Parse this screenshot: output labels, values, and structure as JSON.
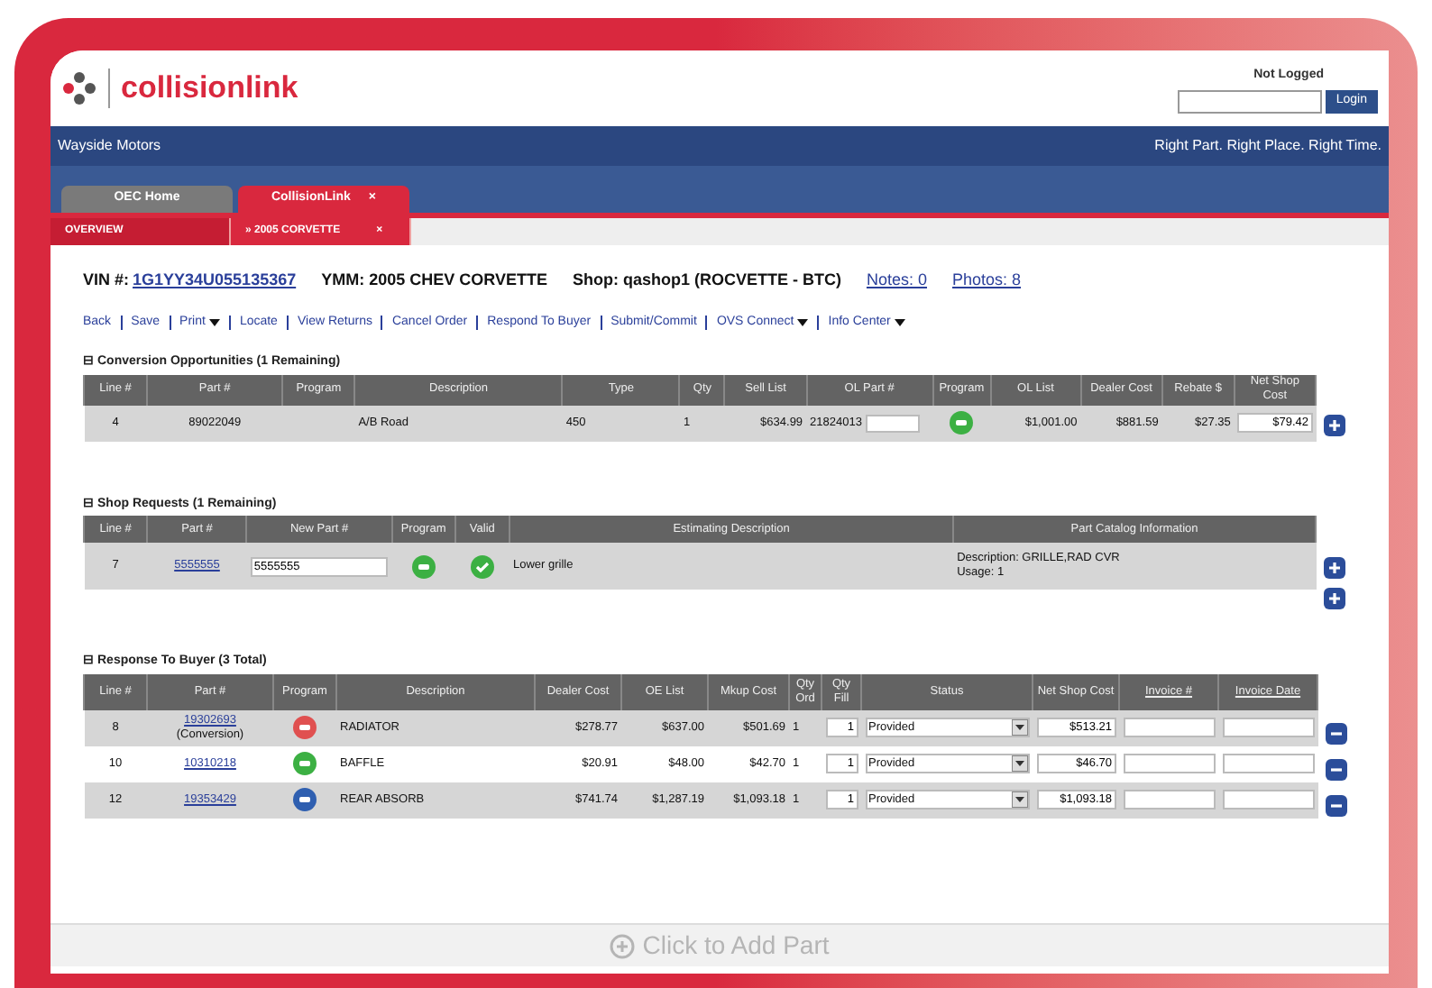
{
  "header": {
    "logo": "collisionlink",
    "login_label": "Not Logged",
    "login_button": "Login"
  },
  "nav": {
    "company": "Wayside Motors",
    "tagline": "Right Part. Right Place. Right Time."
  },
  "tabs": [
    {
      "label": "OEC Home",
      "selected": false
    },
    {
      "label": "CollisionLink",
      "selected": true,
      "close": "×"
    }
  ],
  "subtabs": [
    {
      "label": "OVERVIEW",
      "selected": false
    },
    {
      "label": "» 2005 CORVETTE",
      "selected": true,
      "close": "×"
    }
  ],
  "vehicle": {
    "vin_label": "VIN #:",
    "vin": "1G1YY34U055135367",
    "ymm": "YMM: 2005 CHEV CORVETTE",
    "shop": "Shop: qashop1 (ROCVETTE - BTC)",
    "notes": "Notes: 0",
    "photos": "Photos: 8"
  },
  "actions": [
    {
      "label": "Back",
      "dropdown": false
    },
    {
      "label": "Save",
      "dropdown": false
    },
    {
      "label": "Print",
      "dropdown": true
    },
    {
      "label": "Locate",
      "dropdown": false
    },
    {
      "label": "View Returns",
      "dropdown": false
    },
    {
      "label": "Cancel Order",
      "dropdown": false
    },
    {
      "label": "Respond To Buyer",
      "dropdown": false
    },
    {
      "label": "Submit/Commit",
      "dropdown": false
    },
    {
      "label": "OVS Connect",
      "dropdown": true
    },
    {
      "label": "Info Center",
      "dropdown": true
    }
  ],
  "sections": [
    {
      "toggle": "⊟",
      "title": "Conversion Opportunities (1 Remaining)",
      "columns": [
        "Line #",
        "Part #",
        "Program",
        "Description",
        "Type",
        "Qty",
        "Sell List",
        "OL Part #",
        "Program",
        "OL List",
        "Dealer Cost",
        "Rebate $",
        "Net Shop Cost"
      ],
      "rows": [
        {
          "button": {
            "kind": "add"
          },
          "cells": [
            {
              "kind": "text",
              "text": "4"
            },
            {
              "kind": "text",
              "text": "89022049"
            },
            {
              "kind": "empty"
            },
            {
              "kind": "text",
              "text": "A/B Road"
            },
            {
              "kind": "text",
              "text": "450"
            },
            {
              "kind": "text",
              "text": "1"
            },
            {
              "kind": "text",
              "text": "$634.99"
            },
            {
              "kind": "text_input",
              "text": "21824013"
            },
            {
              "kind": "icon",
              "color": "#3cb043"
            },
            {
              "kind": "text",
              "text": "$1,001.00"
            },
            {
              "kind": "text",
              "text": "$881.59"
            },
            {
              "kind": "text",
              "text": "$27.35"
            },
            {
              "kind": "input",
              "value": "$79.42"
            }
          ]
        }
      ]
    },
    {
      "toggle": "⊟",
      "title": "Shop Requests (1 Remaining)",
      "columns": [
        "Line #",
        "Part #",
        "New Part #",
        "Program",
        "Valid",
        "Estimating Description",
        "Part Catalog Information"
      ],
      "rows": [
        {
          "button": {
            "kind": "add"
          },
          "cells": [
            {
              "kind": "text",
              "text": "7"
            },
            {
              "kind": "link",
              "text": "5555555"
            },
            {
              "kind": "input",
              "value": "5555555"
            },
            {
              "kind": "icon",
              "color": "#3cb043"
            },
            {
              "kind": "check"
            },
            {
              "kind": "text",
              "text": "Lower grille"
            },
            {
              "kind": "lines",
              "lines": [
                "Description: GRILLE,RAD CVR",
                "Usage: 1"
              ]
            }
          ]
        }
      ],
      "extra_button": {
        "kind": "add"
      }
    },
    {
      "toggle": "⊟",
      "title": "Response To Buyer (3 Total)",
      "columns": [
        "Line #",
        "Part #",
        "Program",
        "Description",
        "Dealer Cost",
        "OE List",
        "Mkup Cost",
        "Qty Ord",
        "Qty Fill",
        "Status",
        "Net Shop Cost",
        {
          "label": "Invoice #",
          "link": true
        },
        {
          "label": "Invoice Date",
          "link": true
        }
      ],
      "rows": [
        {
          "button": {
            "kind": "remove"
          },
          "cells": [
            {
              "kind": "text",
              "text": "8"
            },
            {
              "kind": "link",
              "text": "19302693",
              "note": "(Conversion)"
            },
            {
              "kind": "icon",
              "color": "#e05050"
            },
            {
              "kind": "text",
              "text": "RADIATOR"
            },
            {
              "kind": "text",
              "text": "$278.77"
            },
            {
              "kind": "text",
              "text": "$637.00"
            },
            {
              "kind": "text",
              "text": "$501.69"
            },
            {
              "kind": "text",
              "text": "1"
            },
            {
              "kind": "input",
              "value": "1"
            },
            {
              "kind": "select",
              "value": "Provided"
            },
            {
              "kind": "input",
              "value": "$513.21"
            },
            {
              "kind": "input"
            },
            {
              "kind": "input"
            }
          ]
        },
        {
          "button": {
            "kind": "remove"
          },
          "cells": [
            {
              "kind": "text",
              "text": "10"
            },
            {
              "kind": "link",
              "text": "10310218"
            },
            {
              "kind": "icon",
              "color": "#3cb043"
            },
            {
              "kind": "text",
              "text": "BAFFLE"
            },
            {
              "kind": "text",
              "text": "$20.91"
            },
            {
              "kind": "text",
              "text": "$48.00"
            },
            {
              "kind": "text",
              "text": "$42.70"
            },
            {
              "kind": "text",
              "text": "1"
            },
            {
              "kind": "input",
              "value": "1"
            },
            {
              "kind": "select",
              "value": "Provided"
            },
            {
              "kind": "input",
              "value": "$46.70"
            },
            {
              "kind": "input"
            },
            {
              "kind": "input"
            }
          ]
        },
        {
          "button": {
            "kind": "remove"
          },
          "cells": [
            {
              "kind": "text",
              "text": "12"
            },
            {
              "kind": "link",
              "text": "19353429"
            },
            {
              "kind": "icon",
              "color": "#2f5fb0"
            },
            {
              "kind": "text",
              "text": "REAR ABSORB"
            },
            {
              "kind": "text",
              "text": "$741.74"
            },
            {
              "kind": "text",
              "text": "$1,287.19"
            },
            {
              "kind": "text",
              "text": "$1,093.18"
            },
            {
              "kind": "text",
              "text": "1"
            },
            {
              "kind": "input",
              "value": "1"
            },
            {
              "kind": "select",
              "value": "Provided"
            },
            {
              "kind": "input",
              "value": "$1,093.18"
            },
            {
              "kind": "input"
            },
            {
              "kind": "input"
            }
          ]
        }
      ]
    }
  ],
  "add_part": "Click to Add Part"
}
